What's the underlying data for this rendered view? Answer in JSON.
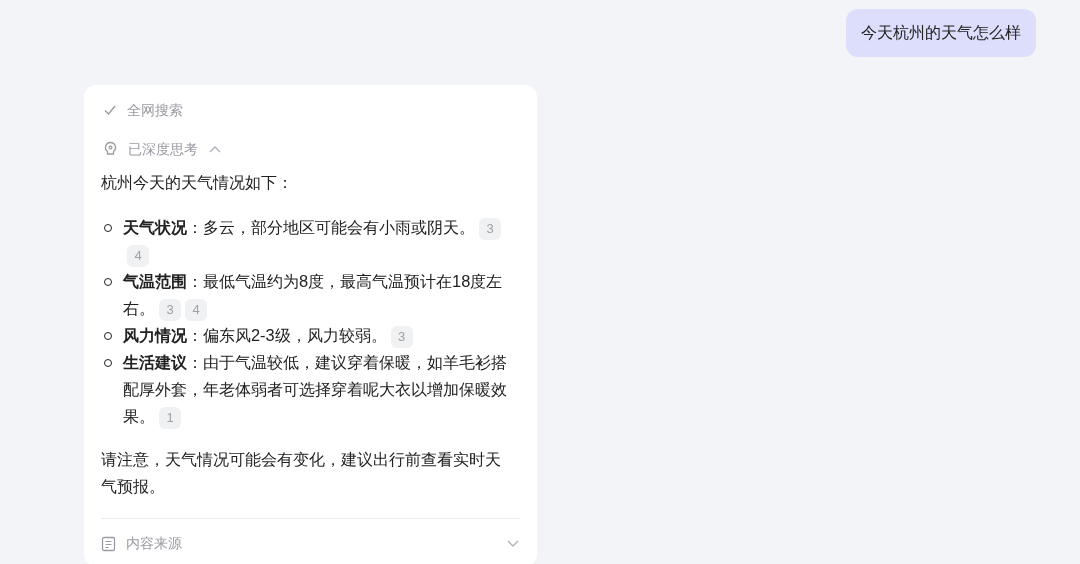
{
  "user_message": "今天杭州的天气怎么样",
  "steps": [
    {
      "kind": "search",
      "label": "全网搜索",
      "done": true
    },
    {
      "kind": "thinking",
      "label": "已深度思考",
      "expanded": true
    }
  ],
  "answer": {
    "intro": "杭州今天的天气情况如下：",
    "items": [
      {
        "label": "天气状况",
        "text": "：多云，部分地区可能会有小雨或阴天。",
        "citations": [
          "3",
          "4"
        ]
      },
      {
        "label": "气温范围",
        "text": "：最低气温约为8度，最高气温预计在18度左右。",
        "citations": [
          "3",
          "4"
        ]
      },
      {
        "label": "风力情况",
        "text": "：偏东风2-3级，风力较弱。",
        "citations": [
          "3"
        ]
      },
      {
        "label": "生活建议",
        "text": "：由于气温较低，建议穿着保暖，如羊毛衫搭配厚外套，年老体弱者可选择穿着呢大衣以增加保暖效果。",
        "citations": [
          "1"
        ]
      }
    ],
    "note": "请注意，天气情况可能会有变化，建议出行前查看实时天气预报。"
  },
  "sources": {
    "label": "内容来源",
    "expanded": false
  }
}
